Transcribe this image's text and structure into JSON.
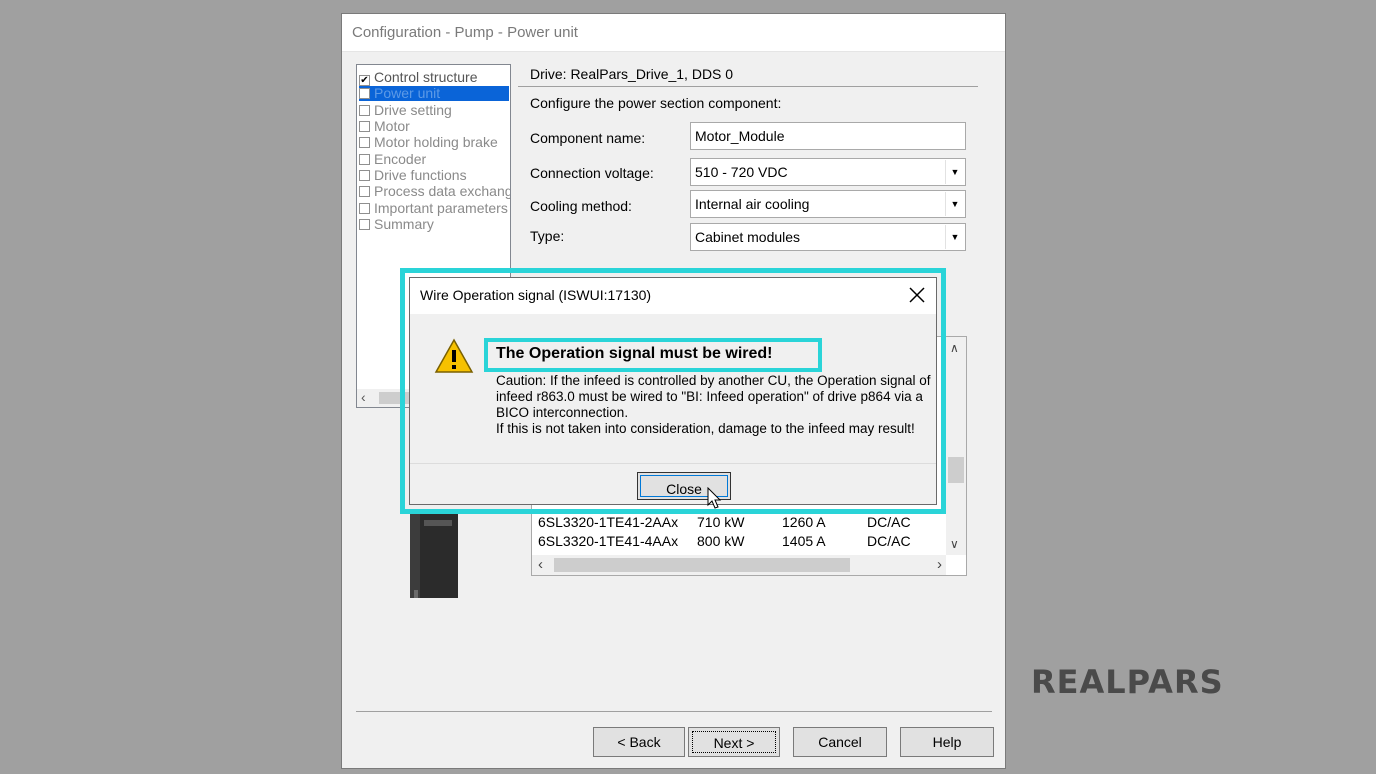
{
  "window": {
    "title": "Configuration - Pump - Power unit"
  },
  "nav": {
    "items": [
      {
        "label": "Control structure",
        "checked": "✔",
        "state": "checked"
      },
      {
        "label": "Power unit",
        "checked": "",
        "state": "selected"
      },
      {
        "label": "Drive setting",
        "checked": "",
        "state": "normal"
      },
      {
        "label": "Motor",
        "checked": "",
        "state": "normal"
      },
      {
        "label": "Motor holding brake",
        "checked": "",
        "state": "normal"
      },
      {
        "label": "Encoder",
        "checked": "",
        "state": "normal"
      },
      {
        "label": "Drive functions",
        "checked": "",
        "state": "normal"
      },
      {
        "label": "Process data exchang",
        "checked": "",
        "state": "normal"
      },
      {
        "label": "Important parameters",
        "checked": "",
        "state": "normal"
      },
      {
        "label": "Summary",
        "checked": "",
        "state": "normal"
      }
    ]
  },
  "drive": {
    "label": "Drive: RealPars_Drive_1, DDS 0"
  },
  "config": {
    "description": "Configure the power section component:",
    "component_name_label": "Component name:",
    "component_name_value": "Motor_Module",
    "connection_voltage_label": "Connection voltage:",
    "connection_voltage_value": "510 - 720 VDC",
    "cooling_method_label": "Cooling method:",
    "cooling_method_value": "Internal air cooling",
    "type_label": "Type:",
    "type_value": "Cabinet modules"
  },
  "component_list": {
    "rows": [
      [
        "6SL3320-1TE41-2AAx",
        "710 kW",
        "1260 A",
        "DC/AC"
      ],
      [
        "6SL3320-1TE41-4AAx",
        "800 kW",
        "1405 A",
        "DC/AC"
      ]
    ]
  },
  "buttons": {
    "back": "< Back",
    "next": "Next >",
    "cancel": "Cancel",
    "help": "Help"
  },
  "dialog": {
    "title": "Wire Operation signal (ISWUI:17130)",
    "headline": "The Operation signal must be wired!",
    "lines": [
      "Caution: If the infeed is controlled by another CU, the Operation signal of",
      "infeed r863.0 must be wired to \"BI: Infeed operation\" of drive p864 via a",
      "BICO interconnection.",
      "If this is not taken into consideration, damage to the infeed may result!"
    ],
    "close_label": "Close",
    "close_icon": "close-icon",
    "warning_icon": "warning-icon"
  },
  "logo": {
    "text": "REALPARS"
  },
  "colors": {
    "highlight": "#2ad4d8",
    "selection": "#0a64d8"
  }
}
